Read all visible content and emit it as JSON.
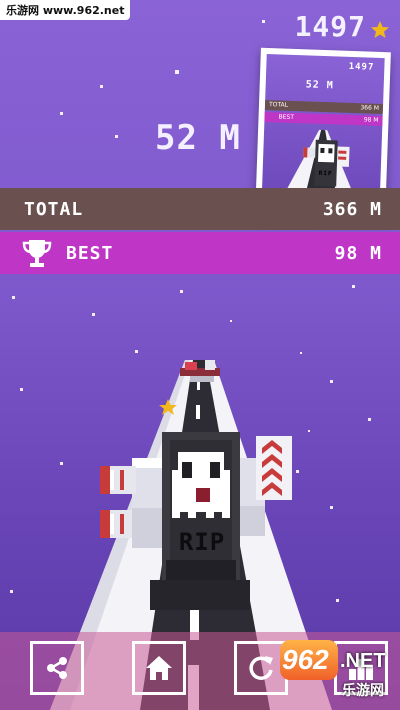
{
  "watermark_top": "乐游网 www.962.net",
  "score": "1497",
  "distance": "52 M",
  "total": {
    "label": "TOTAL",
    "value": "366 M"
  },
  "best": {
    "label": "BEST",
    "value": "98 M"
  },
  "thumbnail": {
    "score": "1497",
    "distance": "52 M",
    "total_label": "TOTAL",
    "total_value": "366 M",
    "best_label": "BEST",
    "best_value": "98 M",
    "tomb_text": "RIP"
  },
  "tomb_text": "RIP",
  "buttons": [
    "share-icon",
    "home-icon",
    "restart-icon",
    "leaderboard-icon"
  ],
  "watermark_bottom": {
    "brand": "962",
    "suffix": ".NET",
    "cn": "乐游网"
  },
  "colors": {
    "sky_top": "#8a63d6",
    "total_row": "#6b5050",
    "best_row": "#bf36c7",
    "star": "#f2b81b",
    "road": "#2d2b33"
  }
}
